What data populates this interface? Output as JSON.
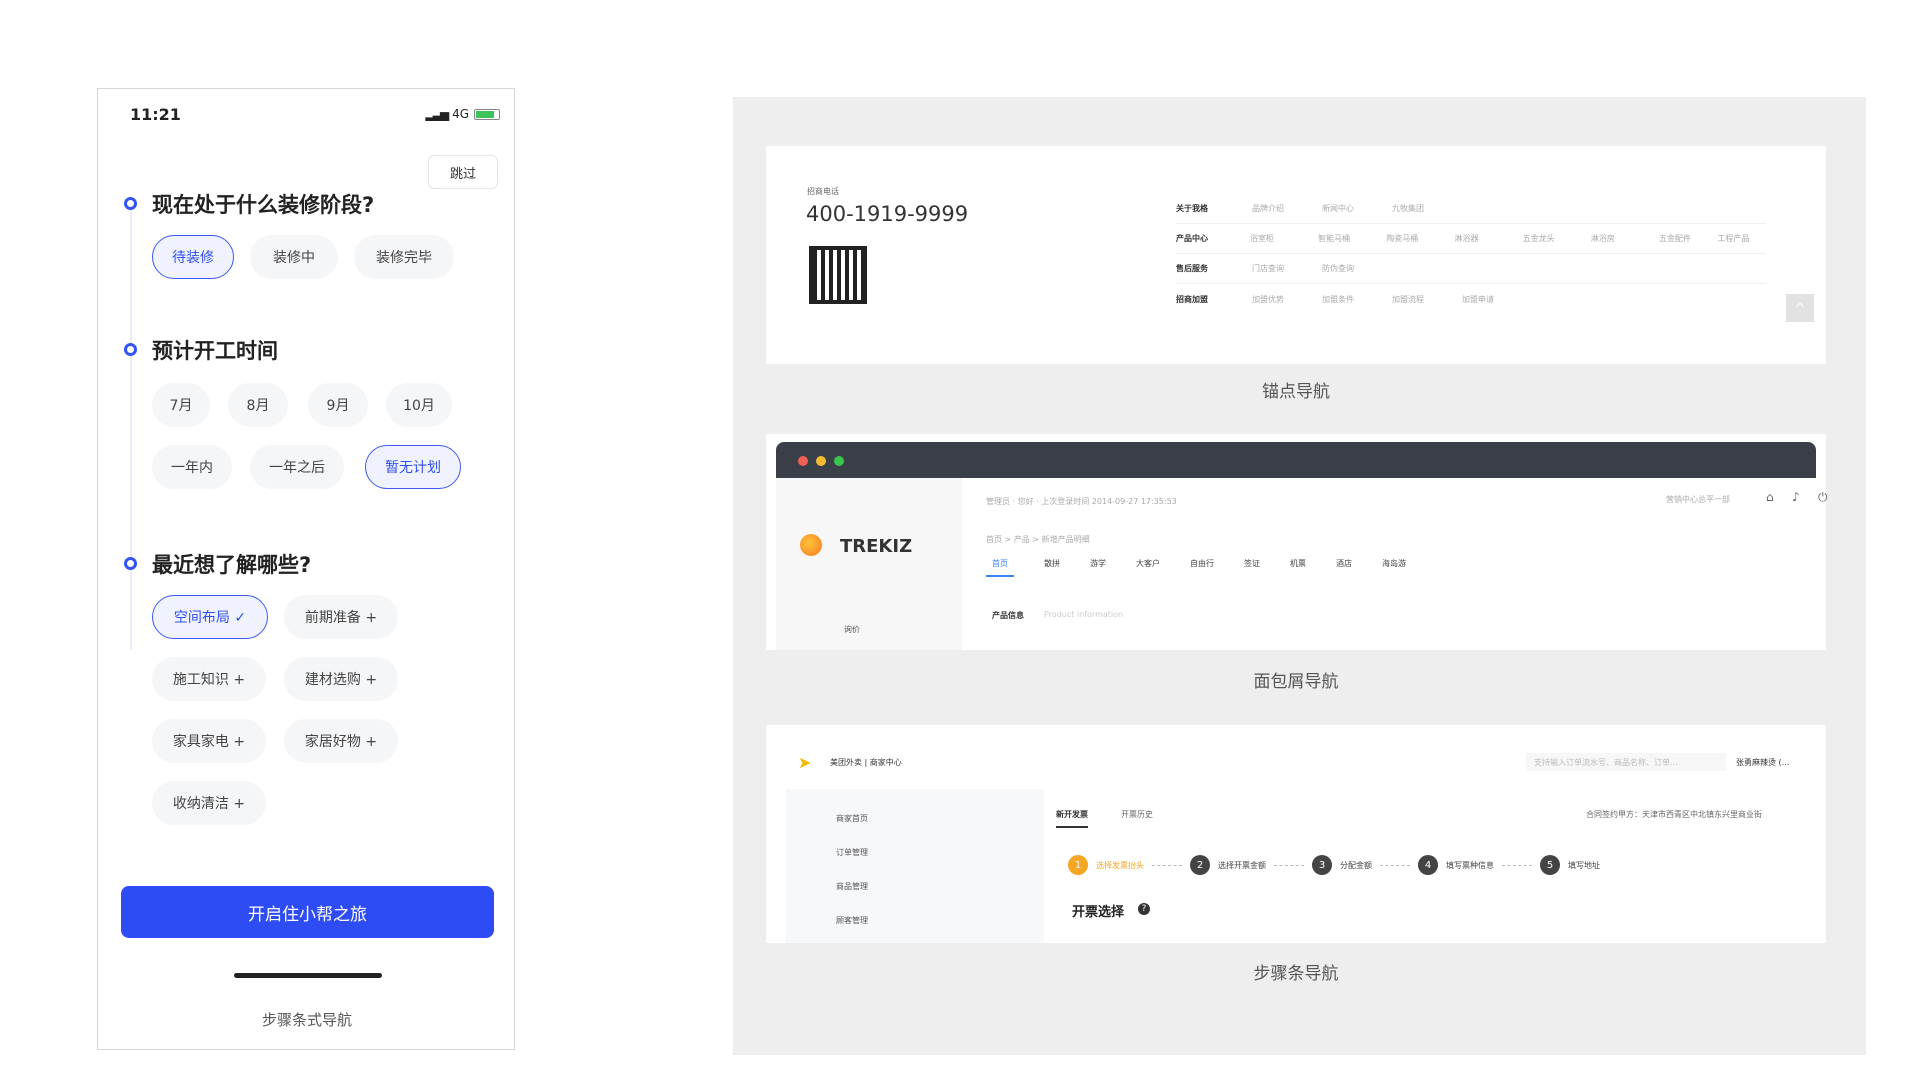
{
  "phone": {
    "time": "11:21",
    "network": "4G",
    "skip": "跳过",
    "q1": {
      "title": "现在处于什么装修阶段?",
      "options": [
        "待装修",
        "装修中",
        "装修完毕"
      ]
    },
    "q2": {
      "title": "预计开工时间",
      "options": [
        "7月",
        "8月",
        "9月",
        "10月",
        "一年内",
        "一年之后",
        "暂无计划"
      ]
    },
    "q3": {
      "title": "最近想了解哪些?",
      "options": [
        "空间布局 ✓",
        "前期准备 +",
        "施工知识 +",
        "建材选购 +",
        "家具家电 +",
        "家居好物 +",
        "收纳清洁 +"
      ]
    },
    "cta": "开启住小帮之旅",
    "caption": "步骤条式导航"
  },
  "anchor": {
    "phone_label": "招商电话",
    "phone": "400-1919-9999",
    "rows": [
      {
        "head": "关于我格",
        "items": [
          "品牌介绍",
          "新闻中心",
          "九牧集团"
        ]
      },
      {
        "head": "产品中心",
        "items": [
          "浴室柜",
          "智能马桶",
          "陶瓷马桶",
          "淋浴器",
          "五金龙头",
          "淋浴房",
          "五金配件",
          "工程产品"
        ]
      },
      {
        "head": "售后服务",
        "items": [
          "门店查询",
          "防伪查询"
        ]
      },
      {
        "head": "招商加盟",
        "items": [
          "加盟优势",
          "加盟条件",
          "加盟流程",
          "加盟申请"
        ]
      }
    ],
    "caption": "锚点导航"
  },
  "breadcrumb": {
    "logo": "TREKIZ",
    "top_info": "管理员 · 您好 · 上次登录时间 2014-09-27 17:35:53",
    "top_right": "营销中心总平一部",
    "path": "首页 > 产品 > 新增产品明细",
    "tabs": [
      "首页",
      "散拼",
      "游学",
      "大客户",
      "自由行",
      "签证",
      "机票",
      "酒店",
      "海岛游"
    ],
    "section": "产品信息",
    "section_en": "Product information",
    "side": "询价",
    "caption": "面包屑导航"
  },
  "steps": {
    "brand": "美团外卖 | 商家中心",
    "search": "支持输入订单流水号、商品名称、订单...",
    "user": "张勇麻辣烫 (...",
    "side": [
      "商家首页",
      "订单管理",
      "商品管理",
      "顾客管理"
    ],
    "tabs": [
      "新开发票",
      "开票历史"
    ],
    "contract": "合同签约甲方：天津市西青区中北镇东兴里商业街",
    "step_list": [
      "选择发票抬头",
      "选择开票金额",
      "分配金额",
      "填写票种信息",
      "填写地址"
    ],
    "title": "开票选择",
    "caption": "步骤条导航"
  },
  "colors": {
    "primary": "#2e4cf4",
    "orange": "#f5a623",
    "dark": "#3b4048"
  }
}
